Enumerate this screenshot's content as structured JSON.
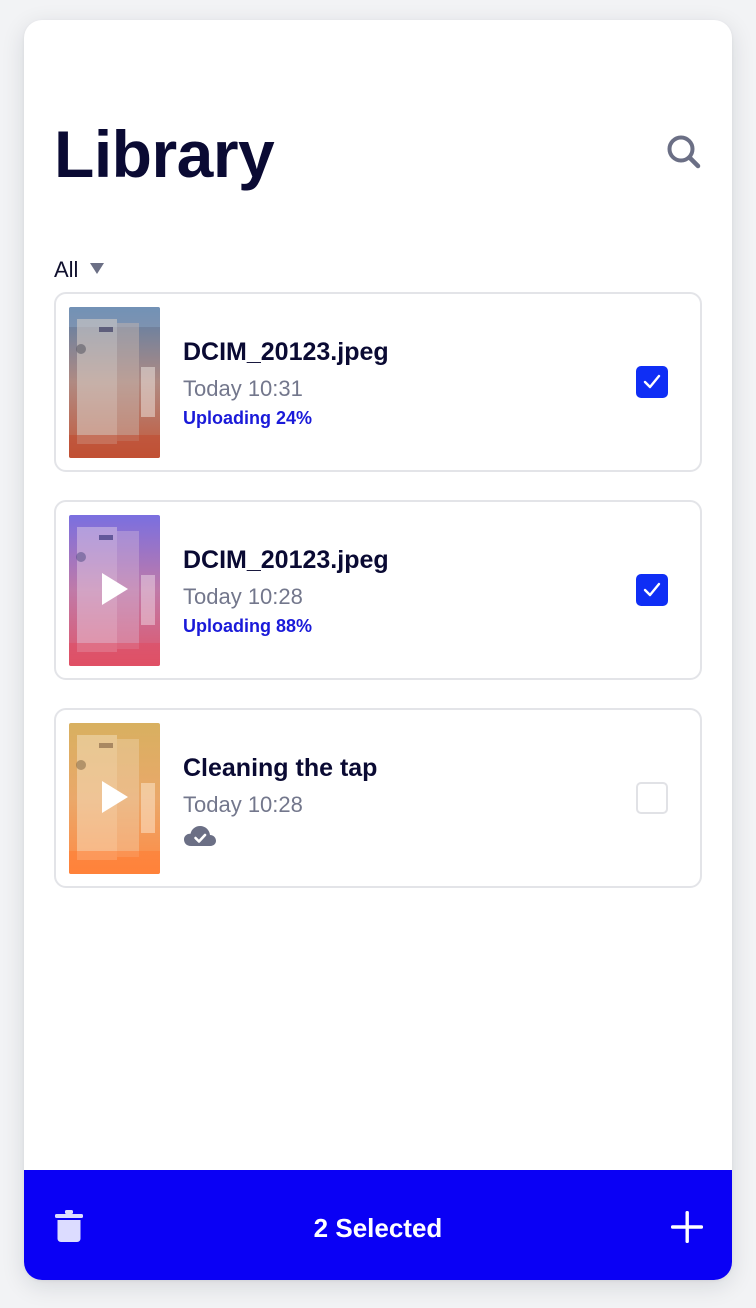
{
  "header": {
    "title": "Library",
    "search_icon": "search-icon"
  },
  "filter": {
    "selected": "All",
    "caret_icon": "caret-down-icon"
  },
  "items": [
    {
      "name": "DCIM_20123.jpeg",
      "time": "Today 10:31",
      "status": "Uploading 24%",
      "upload_progress": 0.24,
      "type": "image",
      "checked": true,
      "thumbnail_tint": "#b8624a"
    },
    {
      "name": "DCIM_20123.jpeg",
      "time": "Today 10:28",
      "status": "Uploading 88%",
      "upload_progress": 0.88,
      "type": "video",
      "checked": true,
      "thumbnail_tint": "#c8506e"
    },
    {
      "name": "Cleaning the tap",
      "time": "Today 10:28",
      "status_icon": "cloud-check-icon",
      "type": "video",
      "checked": false,
      "thumbnail_tint": "#f0904a"
    }
  ],
  "bottom_bar": {
    "selected_label": "2 Selected",
    "delete_icon": "trash-icon",
    "add_icon": "plus-icon",
    "background": "#0a00f5"
  },
  "colors": {
    "accent": "#0f2ef5",
    "title": "#0a0a33",
    "muted": "#73778c",
    "status": "#1a1ad9"
  }
}
